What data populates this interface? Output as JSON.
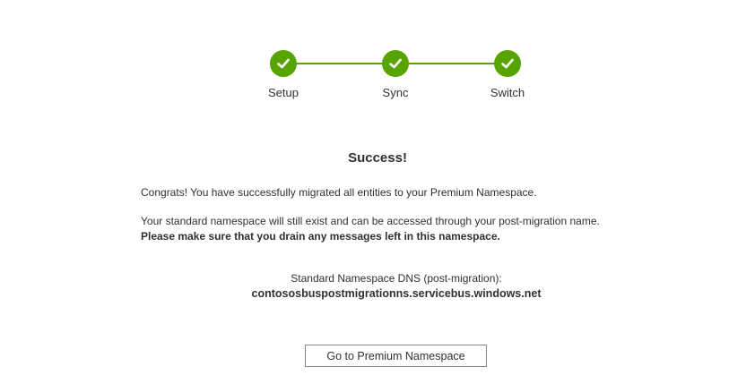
{
  "stepper": {
    "color": "#57a300",
    "steps": [
      {
        "label": "Setup",
        "status": "complete",
        "icon": "checkmark-icon"
      },
      {
        "label": "Sync",
        "status": "complete",
        "icon": "checkmark-icon"
      },
      {
        "label": "Switch",
        "status": "complete",
        "icon": "checkmark-icon"
      }
    ]
  },
  "result": {
    "title": "Success!",
    "congrats": "Congrats! You have successfully migrated all entities to your Premium Namespace.",
    "info": "Your standard namespace will still exist and can be accessed through your post-migration name.",
    "warning": "Please make sure that you drain any messages left in this namespace."
  },
  "dns": {
    "label": "Standard Namespace DNS (post-migration):",
    "value": "contososbuspostmigrationns.servicebus.windows.net"
  },
  "actions": {
    "go_premium_label": "Go to Premium Namespace"
  }
}
